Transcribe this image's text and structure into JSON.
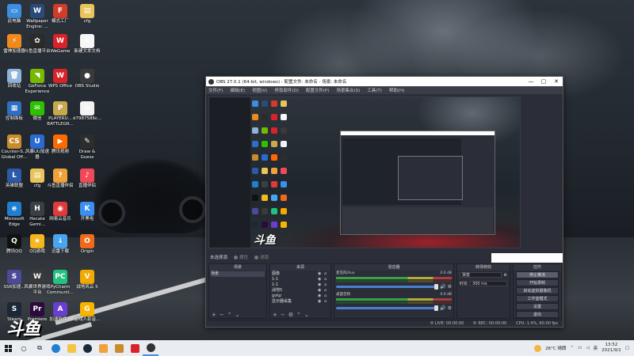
{
  "desktop": {
    "icons": [
      {
        "label": "此电脑",
        "color": "#3c8ede",
        "glyph": "▭"
      },
      {
        "label": "Wallpaper\nEngine: ...",
        "color": "#2a4a7a",
        "glyph": "W"
      },
      {
        "label": "模式工厂",
        "color": "#d33b2b",
        "glyph": "F"
      },
      {
        "label": "cfg",
        "color": "#e8c45a",
        "glyph": "▤"
      },
      {
        "label": "雷神加速器",
        "color": "#f08a1c",
        "glyph": "⚡"
      },
      {
        "label": "斗鱼直播平台",
        "color": "#2b2b2b",
        "glyph": "✿"
      },
      {
        "label": "WeGame",
        "color": "#d8232a",
        "glyph": "W"
      },
      {
        "label": "新建文本文档",
        "color": "#f7f7f7",
        "glyph": "≡"
      },
      {
        "label": "回收站",
        "color": "#8fb3d9",
        "glyph": "🗑"
      },
      {
        "label": "GeForce\nExperience",
        "color": "#76b900",
        "glyph": "◥"
      },
      {
        "label": "WPS Office",
        "color": "#d8232a",
        "glyph": "W"
      },
      {
        "label": "OBS Studio",
        "color": "#3a3a3a",
        "glyph": "●"
      },
      {
        "label": "控制面板",
        "color": "#2e6fc2",
        "glyph": "▦"
      },
      {
        "label": "微信",
        "color": "#2dc100",
        "glyph": "✉"
      },
      {
        "label": "PLAYERU...\nBATTLEGR...",
        "color": "#c8a84e",
        "glyph": "P"
      },
      {
        "label": "d7987586c...",
        "color": "#f2f2f2",
        "glyph": "≡"
      },
      {
        "label": "Counter-S...\nGlobal Off...",
        "color": "#c98c2b",
        "glyph": "CS"
      },
      {
        "label": "风暴UU加速\n器",
        "color": "#2a6bd1",
        "glyph": "U"
      },
      {
        "label": "腾讯视频",
        "color": "#ff6a00",
        "glyph": "▶"
      },
      {
        "label": "Draw &\nGuess",
        "color": "#2d2d2d",
        "glyph": "✎"
      },
      {
        "label": "英雄联盟",
        "color": "#2b5aa8",
        "glyph": "L"
      },
      {
        "label": "cfg",
        "color": "#e8c45a",
        "glyph": "▤"
      },
      {
        "label": "斗鱼直播伴侣",
        "color": "#f0a13a",
        "glyph": "?"
      },
      {
        "label": "直播伴侣",
        "color": "#f04a5a",
        "glyph": "♪"
      },
      {
        "label": "Microsoft\nEdge",
        "color": "#1f7fd3",
        "glyph": "e"
      },
      {
        "label": "Hecate\nGemi...",
        "color": "#3a3f46",
        "glyph": "H"
      },
      {
        "label": "网易云音乐",
        "color": "#e03a3a",
        "glyph": "◉"
      },
      {
        "label": "开黑啦",
        "color": "#3a8ff0",
        "glyph": "K"
      },
      {
        "label": "腾讯QQ",
        "color": "#111111",
        "glyph": "Q"
      },
      {
        "label": "QQ游戏",
        "color": "#f4b71e",
        "glyph": "★"
      },
      {
        "label": "迅雷下载",
        "color": "#4aa5f0",
        "glyph": "↓"
      },
      {
        "label": "Origin",
        "color": "#f06a1c",
        "glyph": "O"
      },
      {
        "label": "SSR加速...",
        "color": "#4b4b9a",
        "glyph": "S"
      },
      {
        "label": "风暴世界游戏\n平台",
        "color": "#3a3a3a",
        "glyph": "W"
      },
      {
        "label": "PyCharm\nCommunit...",
        "color": "#22c27e",
        "glyph": "PC"
      },
      {
        "label": "战地风云 5",
        "color": "#f2a900",
        "glyph": "V"
      },
      {
        "label": "Steam",
        "color": "#1b2838",
        "glyph": "S"
      },
      {
        "label": "Premiere\n...",
        "color": "#2b0a3d",
        "glyph": "Pr"
      },
      {
        "label": "加速软件...",
        "color": "#6a3fd0",
        "glyph": "A"
      },
      {
        "label": "游戏人影音...",
        "color": "#f7b500",
        "glyph": "G"
      }
    ],
    "logo_text": "斗鱼"
  },
  "obs": {
    "title": "OBS 27.0.1 (64-bit, windows) - 配置文件: 未命名 - 场景: 未命名",
    "window_controls": [
      "—",
      "▢",
      "✕"
    ],
    "menu": [
      "文件(F)",
      "编辑(E)",
      "视图(V)",
      "停靠部件(D)",
      "配置文件(P)",
      "场景集合(S)",
      "工具(T)",
      "帮助(H)"
    ],
    "scene_bar": {
      "label": "未选择源",
      "properties": "属性",
      "filters": "滤镜"
    },
    "scenes": {
      "title": "场景",
      "items": [
        "场景"
      ]
    },
    "sources": {
      "title": "来源",
      "items": [
        "图像",
        "1-1",
        "1-1",
        "战地5",
        "gvkp",
        "显示器采集"
      ]
    },
    "mixer": {
      "title": "混音器",
      "tracks": [
        {
          "name": "麦克风/Aux",
          "db": "0.0 dB"
        },
        {
          "name": "桌面音频",
          "db": "0.0 dB"
        }
      ]
    },
    "transitions": {
      "title": "转场特效",
      "type": "渐变",
      "duration_label": "时长",
      "duration_value": "300 ms"
    },
    "controls": {
      "title": "控件",
      "buttons": [
        "停止推流",
        "开始录制",
        "启动虚拟摄像机",
        "工作室模式",
        "设置",
        "退出"
      ]
    },
    "status": {
      "live": "LIVE: 00:00:00",
      "rec": "REC: 00:00:00",
      "cpu": "CPU: 1.4%, 60.00 fps"
    },
    "preview_logo": "斗鱼"
  },
  "taskbar": {
    "search_placeholder": "",
    "weather": "26°C 晴朗",
    "lang": "英",
    "time": "13:52",
    "date": "2021/9/1"
  }
}
